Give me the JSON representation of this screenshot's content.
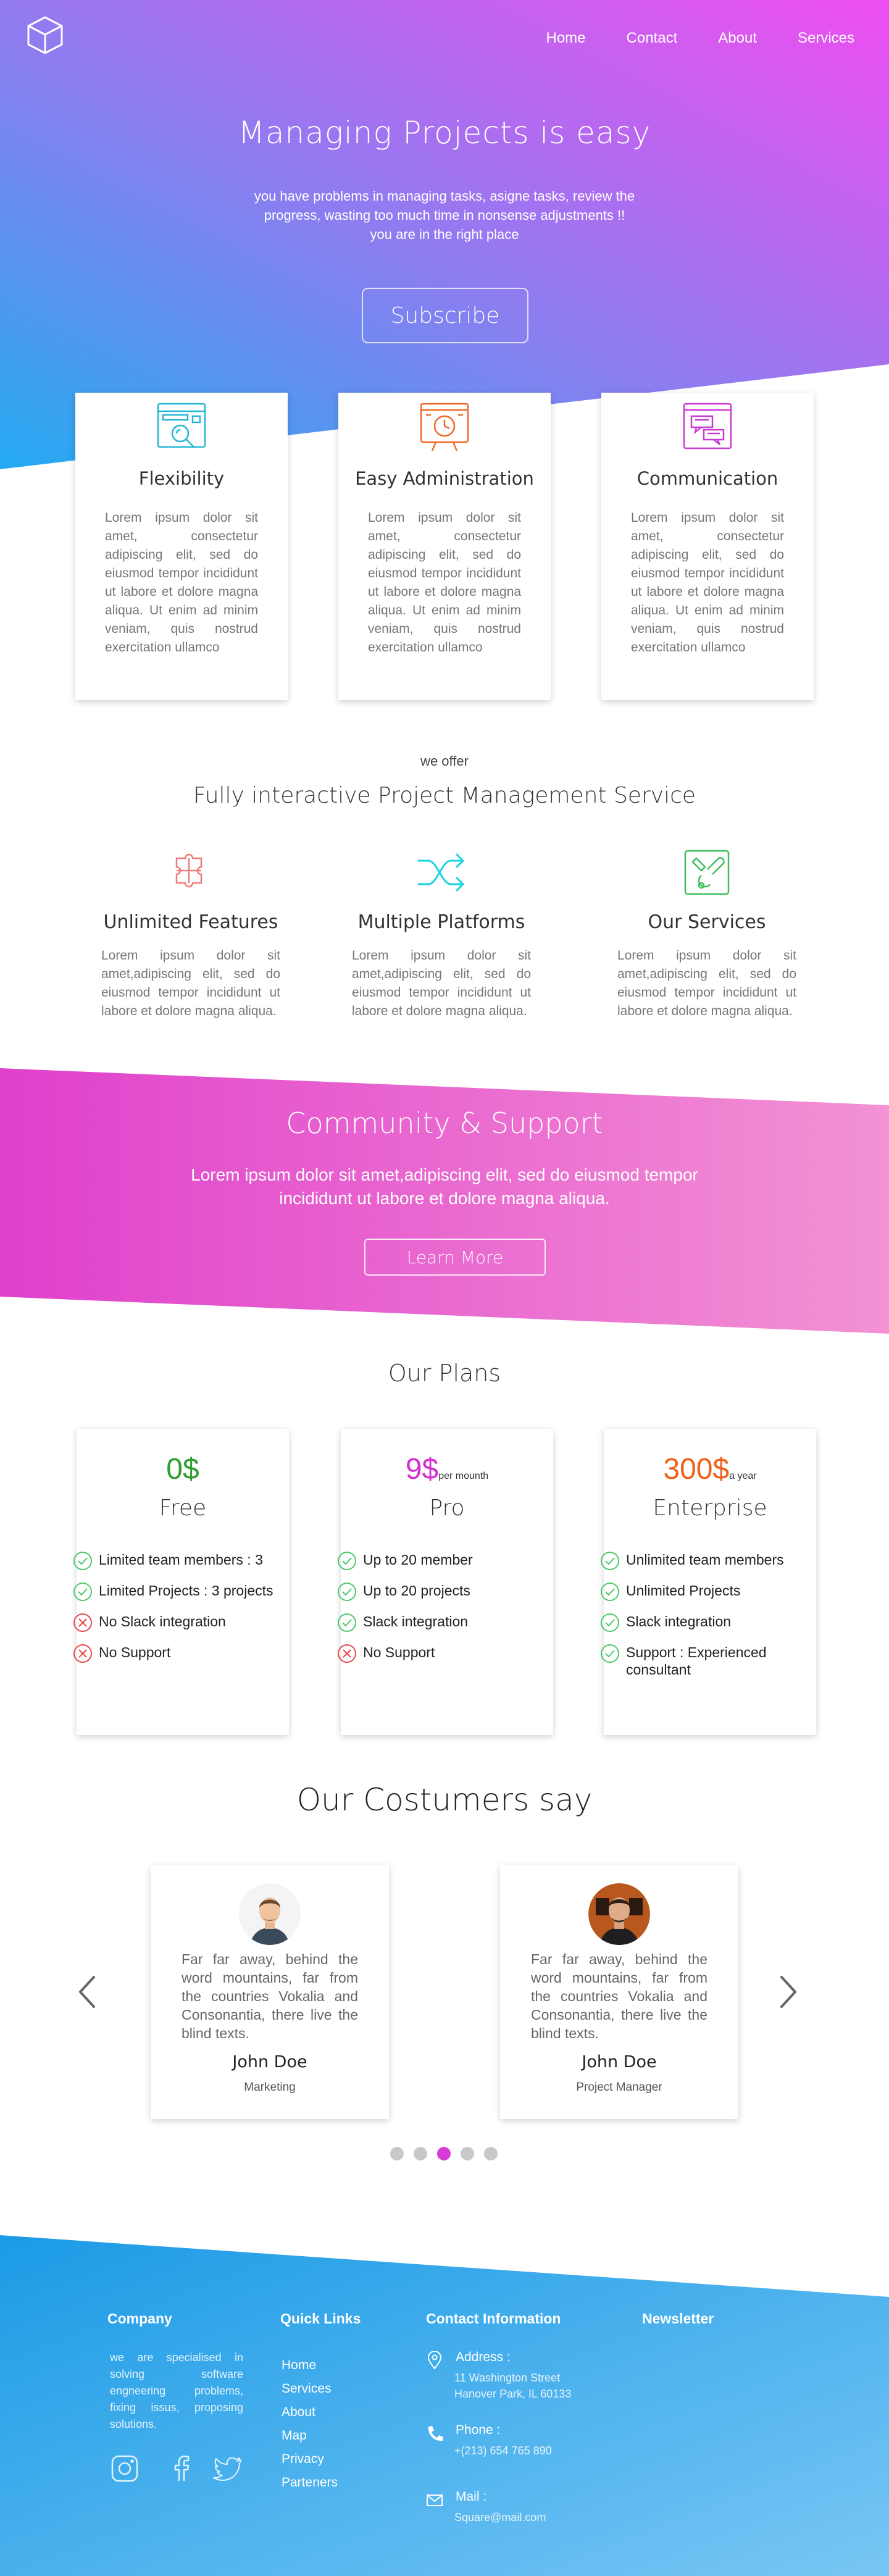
{
  "nav": {
    "logo": "cube-logo-icon",
    "links": [
      "Home",
      "Contact",
      "About",
      "Services"
    ]
  },
  "hero": {
    "title": "Managing Projects is easy",
    "subtitle_line1": "you have problems in managing tasks, asigne tasks, review the",
    "subtitle_line2": "progress, wasting too much time in nonsense adjustments !!",
    "subtitle_line3": "you are in the right place",
    "cta": "Subscribe"
  },
  "features": [
    {
      "title": "Flexibility",
      "icon": "dashboard-search-icon",
      "text": "Lorem ipsum dolor sit amet, consectetur adipiscing elit, sed do eiusmod tempor incididunt ut labore et dolore magna aliqua. Ut enim ad minim veniam, quis nostrud exercitation ullamco"
    },
    {
      "title": "Easy Administration",
      "icon": "presentation-clock-icon",
      "text": "Lorem ipsum dolor sit amet, consectetur adipiscing elit, sed do eiusmod tempor incididunt ut labore et dolore magna aliqua. Ut enim ad minim veniam, quis nostrud exercitation ullamco"
    },
    {
      "title": "Communication",
      "icon": "chat-window-icon",
      "text": "Lorem ipsum dolor sit amet, consectetur adipiscing elit, sed do eiusmod tempor incididunt ut labore et dolore magna aliqua. Ut enim ad minim veniam, quis nostrud exercitation ullamco"
    }
  ],
  "offer": {
    "small": "we offer",
    "title": "Fully interactive Project Management Service",
    "items": [
      {
        "title": "Unlimited Features",
        "icon": "puzzle-icon",
        "text": "Lorem ipsum dolor sit amet,adipiscing elit, sed do eiusmod tempor incididunt ut labore et dolore magna aliqua."
      },
      {
        "title": "Multiple Platforms",
        "icon": "shuffle-icon",
        "text": "Lorem ipsum dolor sit amet,adipiscing elit, sed do eiusmod tempor incididunt ut labore et dolore magna aliqua."
      },
      {
        "title": "Our Services",
        "icon": "tools-icon",
        "text": "Lorem ipsum dolor sit amet,adipiscing elit, sed do eiusmod tempor incididunt ut labore et dolore magna aliqua."
      }
    ]
  },
  "community": {
    "title": "Community & Support",
    "text_line1": "Lorem ipsum dolor sit amet,adipiscing elit, sed do eiusmod tempor",
    "text_line2": "incididunt ut labore et dolore magna aliqua.",
    "cta": "Learn More"
  },
  "plans": {
    "title": "Our Plans",
    "items": [
      {
        "price": "0$",
        "period": "",
        "name": "Free",
        "color": "#2e9e2e",
        "features": [
          {
            "text": "Limited team members : 3",
            "ok": true
          },
          {
            "text": "Limited Projects : 3 projects",
            "ok": true
          },
          {
            "text": "No Slack integration",
            "ok": false
          },
          {
            "text": "No Support",
            "ok": false
          }
        ]
      },
      {
        "price": "9$",
        "period": "per mounth",
        "name": "Pro",
        "color": "#d42fd1",
        "features": [
          {
            "text": "Up to 20 member",
            "ok": true
          },
          {
            "text": "Up to 20 projects",
            "ok": true
          },
          {
            "text": "Slack integration",
            "ok": true
          },
          {
            "text": "No Support",
            "ok": false
          }
        ]
      },
      {
        "price": "300$",
        "period": "a year",
        "name": "Enterprise",
        "color": "#f0611a",
        "features": [
          {
            "text": "Unlimited team members",
            "ok": true
          },
          {
            "text": "Unlimited Projects",
            "ok": true
          },
          {
            "text": "Slack integration",
            "ok": true
          },
          {
            "text": "Support : Experienced consultant",
            "ok": true
          }
        ]
      }
    ]
  },
  "testimonials": {
    "title": "Our Costumers say",
    "items": [
      {
        "text": "Far far away, behind the word mountains, far from the countries Vokalia and Consonantia, there live the blind texts.",
        "name": "John Doe",
        "role": "Marketing"
      },
      {
        "text": "Far far away, behind the word mountains, far from the countries Vokalia and Consonantia, there live the blind texts.",
        "name": "John Doe",
        "role": "Project Manager"
      }
    ],
    "active_dot": 3,
    "dot_count": 5
  },
  "footer": {
    "company_title": "Company",
    "company_text": "we are specialised in solving software engneering problems, fixing issus, proposing solutions.",
    "quick_title": "Quick Links",
    "quick_links": [
      "Home",
      "Services",
      "About",
      "Map",
      "Privacy",
      "Parteners"
    ],
    "contact_title": "Contact Information",
    "address_label": "Address :",
    "address_line1": "11 Washington Street",
    "address_line2": "Hanover Park, IL 60133",
    "phone_label": "Phone :",
    "phone": "+(213) 654 765 890",
    "mail_label": "Mail :",
    "mail": "Square@mail.com",
    "newsletter_title": "Newsletter",
    "social": [
      "instagram-icon",
      "facebook-icon",
      "twitter-icon"
    ]
  }
}
